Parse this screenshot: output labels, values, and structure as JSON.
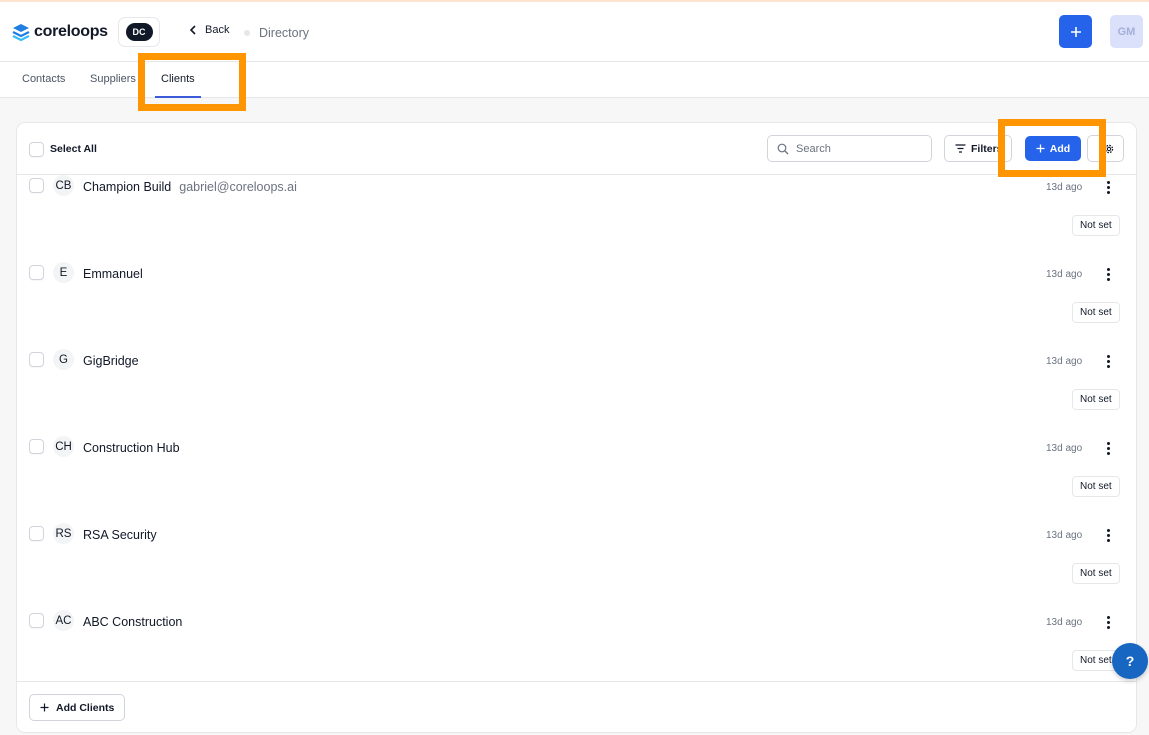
{
  "app": {
    "name": "coreloops",
    "workspace_badge": "DC",
    "user_initials": "GM"
  },
  "header": {
    "back_label": "Back",
    "breadcrumb": "Directory"
  },
  "tabs": [
    {
      "label": "Contacts"
    },
    {
      "label": "Suppliers"
    },
    {
      "label": "Clients",
      "active": true
    }
  ],
  "toolbar": {
    "select_all_label": "Select All",
    "search_placeholder": "Search",
    "filters_label": "Filters",
    "add_label": "Add"
  },
  "clients": [
    {
      "initials": "CB",
      "name": "Champion Build",
      "email": "gabriel@coreloops.ai",
      "updated": "13d ago",
      "status": "Not set"
    },
    {
      "initials": "E",
      "name": "Emmanuel",
      "email": "",
      "updated": "13d ago",
      "status": "Not set"
    },
    {
      "initials": "G",
      "name": "GigBridge",
      "email": "",
      "updated": "13d ago",
      "status": "Not set"
    },
    {
      "initials": "CH",
      "name": "Construction Hub",
      "email": "",
      "updated": "13d ago",
      "status": "Not set"
    },
    {
      "initials": "RS",
      "name": "RSA Security",
      "email": "",
      "updated": "13d ago",
      "status": "Not set"
    },
    {
      "initials": "AC",
      "name": "ABC Construction",
      "email": "",
      "updated": "13d ago",
      "status": "Not set"
    }
  ],
  "footer": {
    "add_clients_label": "Add Clients"
  },
  "help": {
    "label": "?"
  },
  "colors": {
    "primary": "#2563eb",
    "highlight": "#ff9500",
    "help": "#1766c2"
  }
}
